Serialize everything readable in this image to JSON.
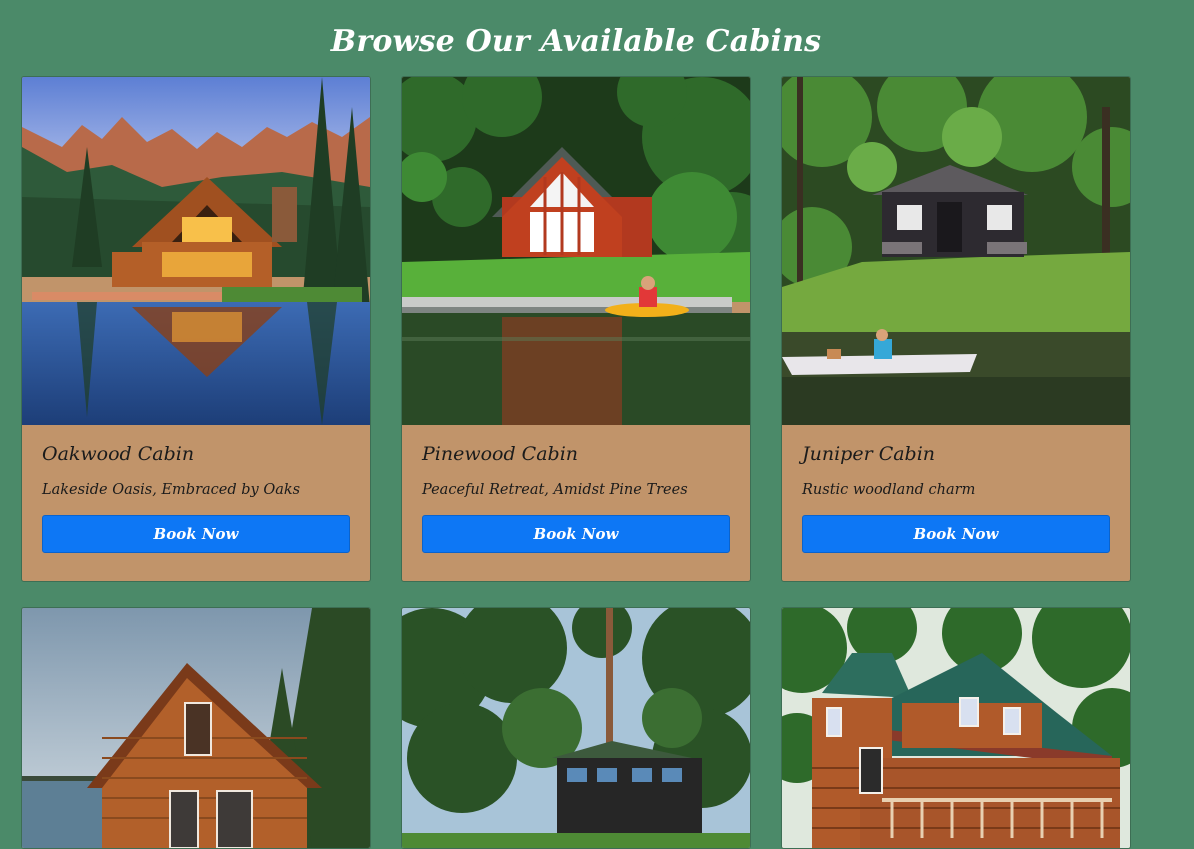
{
  "page": {
    "title": "Browse Our Available Cabins"
  },
  "cabins": [
    {
      "name": "Oakwood Cabin",
      "tagline": "Lakeside Oasis, Embraced by Oaks",
      "button": "Book Now"
    },
    {
      "name": "Pinewood Cabin",
      "tagline": "Peaceful Retreat, Amidst Pine Trees",
      "button": "Book Now"
    },
    {
      "name": "Juniper Cabin",
      "tagline": "Rustic woodland charm",
      "button": "Book Now"
    }
  ],
  "colors": {
    "background": "#4b8a69",
    "card": "#c1946a",
    "button": "#0d77f5"
  }
}
